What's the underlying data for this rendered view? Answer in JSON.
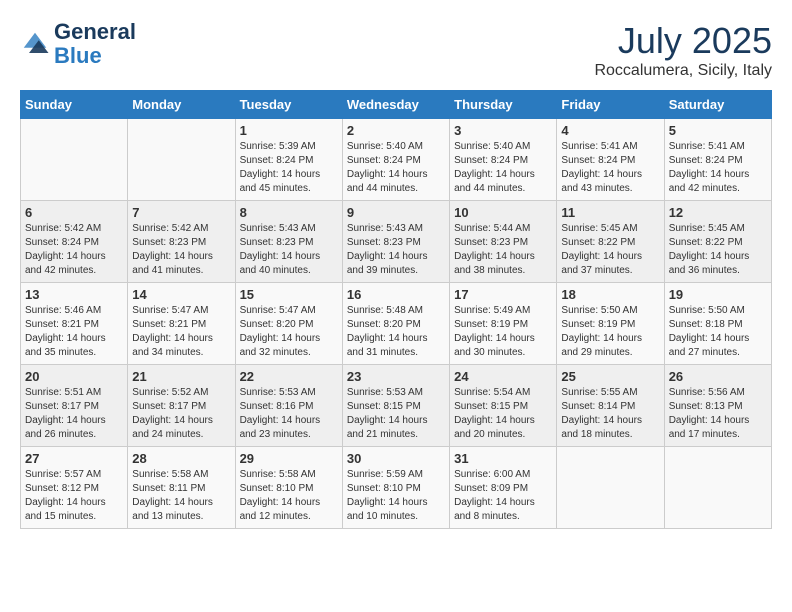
{
  "logo": {
    "line1": "General",
    "line2": "Blue"
  },
  "title": "July 2025",
  "subtitle": "Roccalumera, Sicily, Italy",
  "weekdays": [
    "Sunday",
    "Monday",
    "Tuesday",
    "Wednesday",
    "Thursday",
    "Friday",
    "Saturday"
  ],
  "weeks": [
    [
      {
        "day": "",
        "sunrise": "",
        "sunset": "",
        "daylight": ""
      },
      {
        "day": "",
        "sunrise": "",
        "sunset": "",
        "daylight": ""
      },
      {
        "day": "1",
        "sunrise": "Sunrise: 5:39 AM",
        "sunset": "Sunset: 8:24 PM",
        "daylight": "Daylight: 14 hours and 45 minutes."
      },
      {
        "day": "2",
        "sunrise": "Sunrise: 5:40 AM",
        "sunset": "Sunset: 8:24 PM",
        "daylight": "Daylight: 14 hours and 44 minutes."
      },
      {
        "day": "3",
        "sunrise": "Sunrise: 5:40 AM",
        "sunset": "Sunset: 8:24 PM",
        "daylight": "Daylight: 14 hours and 44 minutes."
      },
      {
        "day": "4",
        "sunrise": "Sunrise: 5:41 AM",
        "sunset": "Sunset: 8:24 PM",
        "daylight": "Daylight: 14 hours and 43 minutes."
      },
      {
        "day": "5",
        "sunrise": "Sunrise: 5:41 AM",
        "sunset": "Sunset: 8:24 PM",
        "daylight": "Daylight: 14 hours and 42 minutes."
      }
    ],
    [
      {
        "day": "6",
        "sunrise": "Sunrise: 5:42 AM",
        "sunset": "Sunset: 8:24 PM",
        "daylight": "Daylight: 14 hours and 42 minutes."
      },
      {
        "day": "7",
        "sunrise": "Sunrise: 5:42 AM",
        "sunset": "Sunset: 8:23 PM",
        "daylight": "Daylight: 14 hours and 41 minutes."
      },
      {
        "day": "8",
        "sunrise": "Sunrise: 5:43 AM",
        "sunset": "Sunset: 8:23 PM",
        "daylight": "Daylight: 14 hours and 40 minutes."
      },
      {
        "day": "9",
        "sunrise": "Sunrise: 5:43 AM",
        "sunset": "Sunset: 8:23 PM",
        "daylight": "Daylight: 14 hours and 39 minutes."
      },
      {
        "day": "10",
        "sunrise": "Sunrise: 5:44 AM",
        "sunset": "Sunset: 8:23 PM",
        "daylight": "Daylight: 14 hours and 38 minutes."
      },
      {
        "day": "11",
        "sunrise": "Sunrise: 5:45 AM",
        "sunset": "Sunset: 8:22 PM",
        "daylight": "Daylight: 14 hours and 37 minutes."
      },
      {
        "day": "12",
        "sunrise": "Sunrise: 5:45 AM",
        "sunset": "Sunset: 8:22 PM",
        "daylight": "Daylight: 14 hours and 36 minutes."
      }
    ],
    [
      {
        "day": "13",
        "sunrise": "Sunrise: 5:46 AM",
        "sunset": "Sunset: 8:21 PM",
        "daylight": "Daylight: 14 hours and 35 minutes."
      },
      {
        "day": "14",
        "sunrise": "Sunrise: 5:47 AM",
        "sunset": "Sunset: 8:21 PM",
        "daylight": "Daylight: 14 hours and 34 minutes."
      },
      {
        "day": "15",
        "sunrise": "Sunrise: 5:47 AM",
        "sunset": "Sunset: 8:20 PM",
        "daylight": "Daylight: 14 hours and 32 minutes."
      },
      {
        "day": "16",
        "sunrise": "Sunrise: 5:48 AM",
        "sunset": "Sunset: 8:20 PM",
        "daylight": "Daylight: 14 hours and 31 minutes."
      },
      {
        "day": "17",
        "sunrise": "Sunrise: 5:49 AM",
        "sunset": "Sunset: 8:19 PM",
        "daylight": "Daylight: 14 hours and 30 minutes."
      },
      {
        "day": "18",
        "sunrise": "Sunrise: 5:50 AM",
        "sunset": "Sunset: 8:19 PM",
        "daylight": "Daylight: 14 hours and 29 minutes."
      },
      {
        "day": "19",
        "sunrise": "Sunrise: 5:50 AM",
        "sunset": "Sunset: 8:18 PM",
        "daylight": "Daylight: 14 hours and 27 minutes."
      }
    ],
    [
      {
        "day": "20",
        "sunrise": "Sunrise: 5:51 AM",
        "sunset": "Sunset: 8:17 PM",
        "daylight": "Daylight: 14 hours and 26 minutes."
      },
      {
        "day": "21",
        "sunrise": "Sunrise: 5:52 AM",
        "sunset": "Sunset: 8:17 PM",
        "daylight": "Daylight: 14 hours and 24 minutes."
      },
      {
        "day": "22",
        "sunrise": "Sunrise: 5:53 AM",
        "sunset": "Sunset: 8:16 PM",
        "daylight": "Daylight: 14 hours and 23 minutes."
      },
      {
        "day": "23",
        "sunrise": "Sunrise: 5:53 AM",
        "sunset": "Sunset: 8:15 PM",
        "daylight": "Daylight: 14 hours and 21 minutes."
      },
      {
        "day": "24",
        "sunrise": "Sunrise: 5:54 AM",
        "sunset": "Sunset: 8:15 PM",
        "daylight": "Daylight: 14 hours and 20 minutes."
      },
      {
        "day": "25",
        "sunrise": "Sunrise: 5:55 AM",
        "sunset": "Sunset: 8:14 PM",
        "daylight": "Daylight: 14 hours and 18 minutes."
      },
      {
        "day": "26",
        "sunrise": "Sunrise: 5:56 AM",
        "sunset": "Sunset: 8:13 PM",
        "daylight": "Daylight: 14 hours and 17 minutes."
      }
    ],
    [
      {
        "day": "27",
        "sunrise": "Sunrise: 5:57 AM",
        "sunset": "Sunset: 8:12 PM",
        "daylight": "Daylight: 14 hours and 15 minutes."
      },
      {
        "day": "28",
        "sunrise": "Sunrise: 5:58 AM",
        "sunset": "Sunset: 8:11 PM",
        "daylight": "Daylight: 14 hours and 13 minutes."
      },
      {
        "day": "29",
        "sunrise": "Sunrise: 5:58 AM",
        "sunset": "Sunset: 8:10 PM",
        "daylight": "Daylight: 14 hours and 12 minutes."
      },
      {
        "day": "30",
        "sunrise": "Sunrise: 5:59 AM",
        "sunset": "Sunset: 8:10 PM",
        "daylight": "Daylight: 14 hours and 10 minutes."
      },
      {
        "day": "31",
        "sunrise": "Sunrise: 6:00 AM",
        "sunset": "Sunset: 8:09 PM",
        "daylight": "Daylight: 14 hours and 8 minutes."
      },
      {
        "day": "",
        "sunrise": "",
        "sunset": "",
        "daylight": ""
      },
      {
        "day": "",
        "sunrise": "",
        "sunset": "",
        "daylight": ""
      }
    ]
  ]
}
